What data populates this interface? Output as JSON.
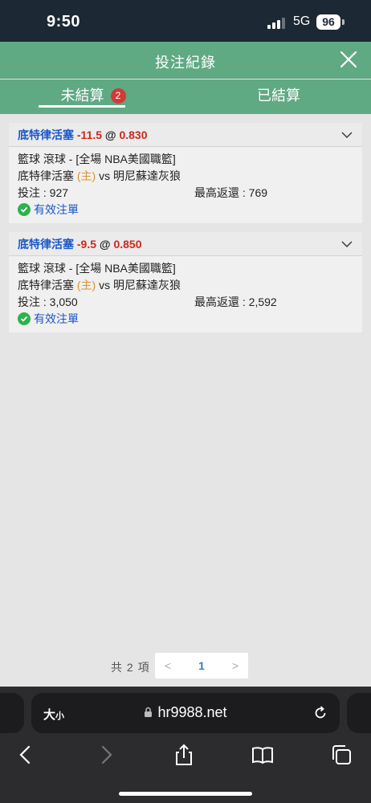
{
  "status_bar": {
    "time": "9:50",
    "network": "5G",
    "battery": "96"
  },
  "header": {
    "title": "投注紀錄"
  },
  "tabs": {
    "unsettled": "未結算",
    "unsettled_badge": "2",
    "settled": "已結算"
  },
  "bets": [
    {
      "team": "底特律活塞",
      "handicap": "-11.5",
      "at": "@",
      "odds": "0.830",
      "sport_market": "籃球 滾球 - [全場 NBA美國職籃]",
      "home_team": "底特律活塞",
      "home_tag": "(主)",
      "vs": "vs",
      "away_team": "明尼蘇達灰狼",
      "stake_label": "投注 : 927",
      "max_return_label": "最高返還 : 769",
      "status": "有效注單"
    },
    {
      "team": "底特律活塞",
      "handicap": "-9.5",
      "at": "@",
      "odds": "0.850",
      "sport_market": "籃球 滾球 - [全場 NBA美國職籃]",
      "home_team": "底特律活塞",
      "home_tag": "(主)",
      "vs": "vs",
      "away_team": "明尼蘇達灰狼",
      "stake_label": "投注 : 3,050",
      "max_return_label": "最高返還 : 2,592",
      "status": "有效注單"
    }
  ],
  "pagination": {
    "total": "共 2 項",
    "prev": "<",
    "current": "1",
    "next": ">"
  },
  "browser": {
    "text_size_big": "大",
    "text_size_small": "小",
    "url": "hr9988.net"
  },
  "colors": {
    "header_green": "#5fa983",
    "team_blue": "#1a57c7",
    "odds_red": "#d0261d",
    "home_orange": "#e0922c",
    "valid_green": "#2eb24c",
    "badge_red": "#d13b35"
  }
}
